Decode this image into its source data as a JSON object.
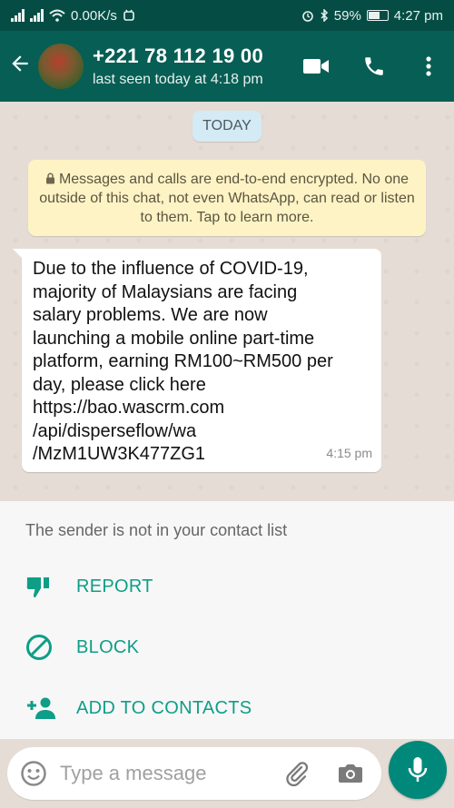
{
  "status_bar": {
    "network_speed": "0.00K/s",
    "battery": "59%",
    "time": "4:27 pm"
  },
  "header": {
    "contact_name": "+221 78 112 19 00",
    "last_seen": "last seen today at 4:18 pm",
    "back_icon": "arrow-left-icon",
    "video_icon": "video-camera-icon",
    "call_icon": "phone-icon",
    "menu_icon": "more-vertical-icon"
  },
  "chat": {
    "date_chip": "TODAY",
    "encryption_notice": "Messages and calls are end-to-end encrypted. No one outside of this chat, not even WhatsApp, can read or listen to them. Tap to learn more.",
    "messages": [
      {
        "text": "Due to the influence of COVID-19,\nmajority of Malaysians are facing\nsalary problems. We are now\nlaunching a mobile online part-time\nplatform, earning RM100~RM500 per\nday, please click here\nhttps://bao.wascrm.com\n/api/disperseflow/wa\n/MzM1UW3K477ZG1",
        "time": "4:15 pm"
      }
    ]
  },
  "unknown_sender": {
    "notice": "The sender is not in your contact list",
    "actions": [
      {
        "label": "REPORT",
        "icon": "thumbs-down-icon"
      },
      {
        "label": "BLOCK",
        "icon": "block-icon"
      },
      {
        "label": "ADD TO CONTACTS",
        "icon": "add-person-icon"
      }
    ]
  },
  "input": {
    "placeholder": "Type a message",
    "emoji_icon": "emoji-icon",
    "attach_icon": "paperclip-icon",
    "camera_icon": "camera-icon",
    "mic_icon": "microphone-icon"
  },
  "colors": {
    "header": "#075e54",
    "status_bar": "#054d44",
    "accent": "#0e9e87",
    "mic_button": "#00897b",
    "notice_bg": "#fdf3c5"
  }
}
